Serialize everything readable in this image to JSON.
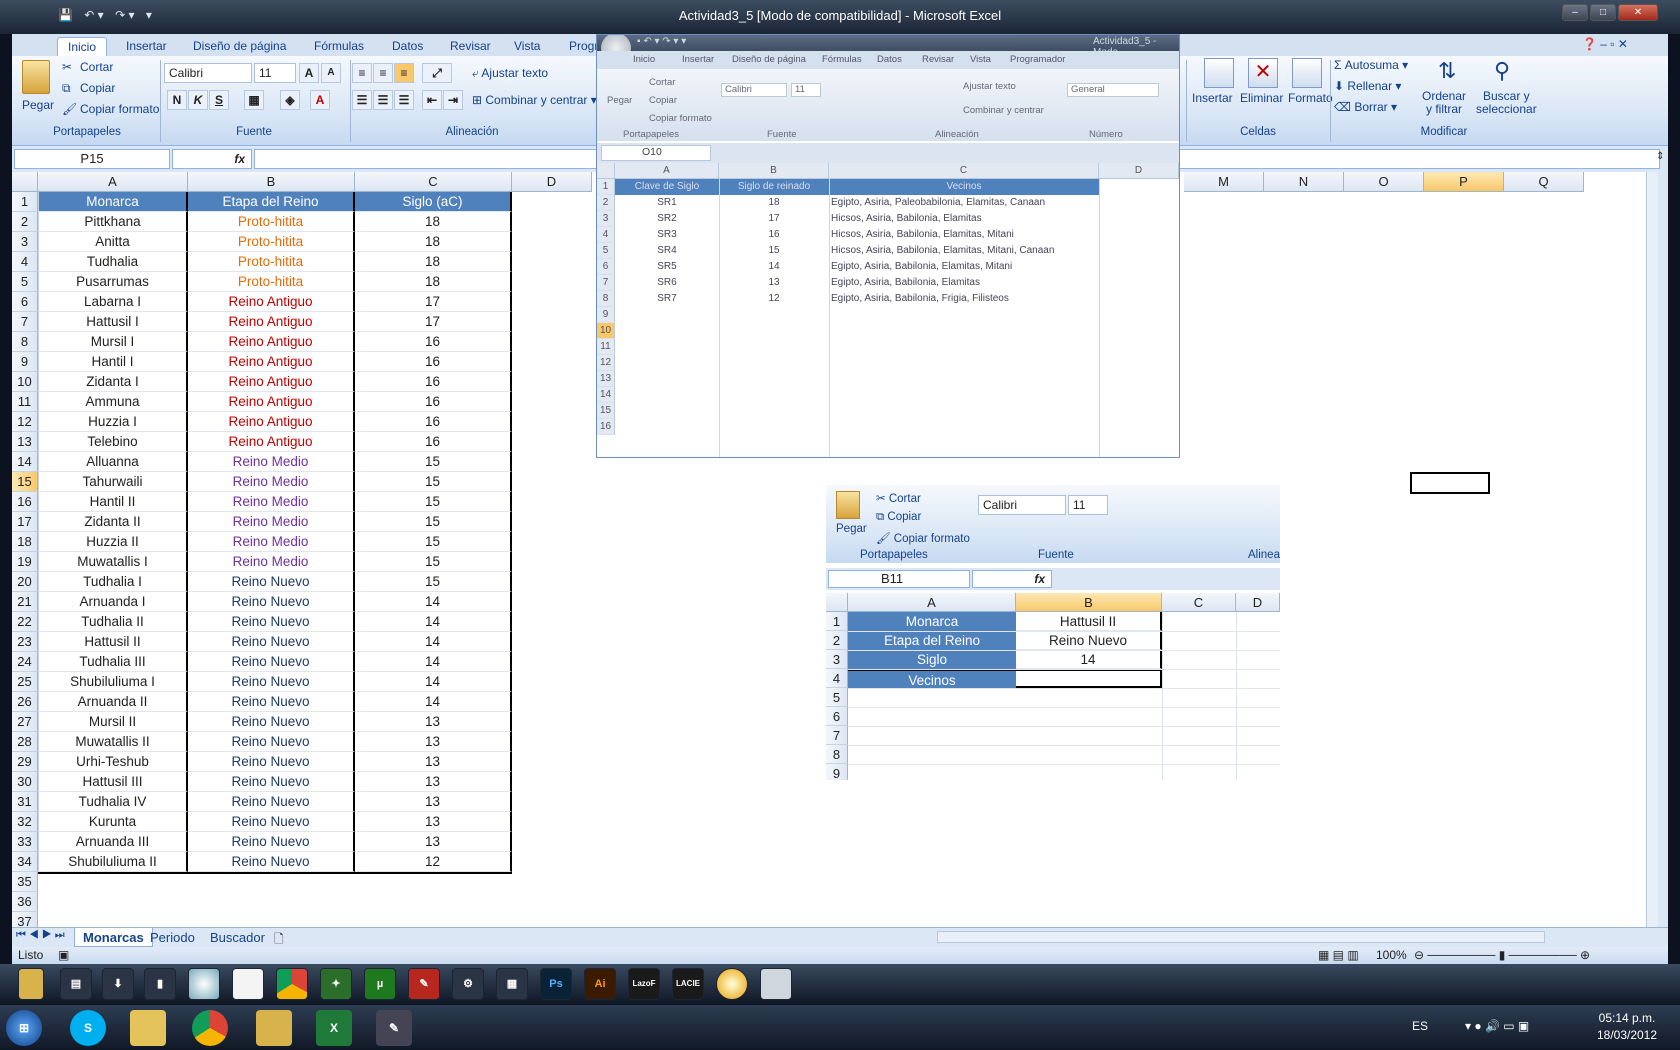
{
  "window": {
    "title": "Actividad3_5  [Modo de compatibilidad] - Microsoft Excel",
    "qat_icons": [
      "save-icon",
      "undo-icon",
      "redo-icon",
      "customize-icon"
    ]
  },
  "ribbon": {
    "tabs": [
      "Inicio",
      "Insertar",
      "Diseño de página",
      "Fórmulas",
      "Datos",
      "Revisar",
      "Vista",
      "Programador"
    ],
    "clipboard": {
      "paste": "Pegar",
      "cut": "Cortar",
      "copy": "Copiar",
      "format_painter": "Copiar formato",
      "label": "Portapapeles"
    },
    "font": {
      "name": "Calibri",
      "size": "11",
      "bold": "N",
      "italic": "K",
      "underline": "S",
      "label": "Fuente"
    },
    "alignment": {
      "wrap": "Ajustar texto",
      "merge": "Combinar y centrar",
      "label": "Alineación"
    },
    "cells": {
      "insert": "Insertar",
      "delete": "Eliminar",
      "format": "Formato",
      "label": "Celdas"
    },
    "editing": {
      "autosum": "Autosuma",
      "fill": "Rellenar",
      "clear": "Borrar",
      "sort": "Ordenar\ny filtrar",
      "find": "Buscar y\nseleccionar",
      "label": "Modificar"
    }
  },
  "formula_bar": {
    "name_box": "P15",
    "fx": "fx",
    "value": ""
  },
  "sheet": {
    "columns": [
      "A",
      "B",
      "C",
      "D",
      "M",
      "N",
      "O",
      "P",
      "Q"
    ],
    "header": [
      "Monarca",
      "Etapa del Reino",
      "Siglo (aC)"
    ],
    "rows": [
      [
        "Pittkhana",
        "Proto-hitita",
        "18"
      ],
      [
        "Anitta",
        "Proto-hitita",
        "18"
      ],
      [
        "Tudhalia",
        "Proto-hitita",
        "18"
      ],
      [
        "Pusarrumas",
        "Proto-hitita",
        "18"
      ],
      [
        "Labarna I",
        "Reino Antiguo",
        "17"
      ],
      [
        "Hattusil I",
        "Reino Antiguo",
        "17"
      ],
      [
        "Mursil I",
        "Reino Antiguo",
        "16"
      ],
      [
        "Hantil I",
        "Reino Antiguo",
        "16"
      ],
      [
        "Zidanta I",
        "Reino Antiguo",
        "16"
      ],
      [
        "Ammuna",
        "Reino Antiguo",
        "16"
      ],
      [
        "Huzzia I",
        "Reino Antiguo",
        "16"
      ],
      [
        "Telebino",
        "Reino Antiguo",
        "16"
      ],
      [
        "Alluanna",
        "Reino Medio",
        "15"
      ],
      [
        "Tahurwaili",
        "Reino Medio",
        "15"
      ],
      [
        "Hantil II",
        "Reino Medio",
        "15"
      ],
      [
        "Zidanta II",
        "Reino Medio",
        "15"
      ],
      [
        "Huzzia II",
        "Reino Medio",
        "15"
      ],
      [
        "Muwatallis I",
        "Reino Medio",
        "15"
      ],
      [
        "Tudhalia I",
        "Reino Nuevo",
        "15"
      ],
      [
        "Arnuanda I",
        "Reino Nuevo",
        "14"
      ],
      [
        "Tudhalia II",
        "Reino Nuevo",
        "14"
      ],
      [
        "Hattusil II",
        "Reino Nuevo",
        "14"
      ],
      [
        "Tudhalia III",
        "Reino Nuevo",
        "14"
      ],
      [
        "Shubiluliuma I",
        "Reino Nuevo",
        "14"
      ],
      [
        "Arnuanda II",
        "Reino Nuevo",
        "14"
      ],
      [
        "Mursil II",
        "Reino Nuevo",
        "13"
      ],
      [
        "Muwatallis II",
        "Reino Nuevo",
        "13"
      ],
      [
        "Urhi-Teshub",
        "Reino Nuevo",
        "13"
      ],
      [
        "Hattusil III",
        "Reino Nuevo",
        "13"
      ],
      [
        "Tudhalia IV",
        "Reino Nuevo",
        "13"
      ],
      [
        "Kurunta",
        "Reino Nuevo",
        "13"
      ],
      [
        "Arnuanda III",
        "Reino Nuevo",
        "13"
      ],
      [
        "Shubiluliuma II",
        "Reino Nuevo",
        "12"
      ]
    ],
    "row_numbers": [
      "1",
      "2",
      "3",
      "4",
      "5",
      "6",
      "7",
      "8",
      "9",
      "10",
      "11",
      "12",
      "13",
      "14",
      "15",
      "16",
      "17",
      "18",
      "19",
      "20",
      "21",
      "22",
      "23",
      "24",
      "25",
      "26",
      "27",
      "28",
      "29",
      "30",
      "31",
      "32",
      "33",
      "34",
      "35",
      "36",
      "37"
    ],
    "tabs": [
      "Monarcas",
      "Periodo",
      "Buscador"
    ]
  },
  "overlay1": {
    "title": "Actividad3_5 - Modo",
    "tabs": [
      "Inicio",
      "Insertar",
      "Diseño de página",
      "Fórmulas",
      "Datos",
      "Revisar",
      "Vista",
      "Programador"
    ],
    "clipboard": {
      "paste": "Pegar",
      "cut": "Cortar",
      "copy": "Copiar",
      "format_painter": "Copiar formato",
      "label": "Portapapeles"
    },
    "font": {
      "name": "Calibri",
      "size": "11",
      "label": "Fuente"
    },
    "alignment": {
      "wrap": "Ajustar texto",
      "merge": "Combinar y centrar",
      "label": "Alineación"
    },
    "number": {
      "format": "General",
      "label": "Número"
    },
    "name_box": "O10",
    "columns": [
      "A",
      "B",
      "C",
      "D"
    ],
    "header": [
      "Clave de Siglo",
      "Siglo de reinado",
      "Vecinos"
    ],
    "rows": [
      [
        "SR1",
        "18",
        "Egipto, Asiria, Paleobabilonia, Elamitas, Canaan"
      ],
      [
        "SR2",
        "17",
        "Hicsos, Asiria, Babilonia, Elamitas"
      ],
      [
        "SR3",
        "16",
        "Hicsos, Asiria, Babilonia, Elamitas, Mitani"
      ],
      [
        "SR4",
        "15",
        "Hicsos, Asiria, Babilonia, Elamitas, Mitani, Canaan"
      ],
      [
        "SR5",
        "14",
        "Egipto, Asiria, Babilonia, Elamitas, Mitani"
      ],
      [
        "SR6",
        "13",
        "Egipto, Asiria, Babilonia, Elamitas"
      ],
      [
        "SR7",
        "12",
        "Egipto, Asiria, Babilonia, Frigia, Filisteos"
      ]
    ],
    "row_numbers": [
      "1",
      "2",
      "3",
      "4",
      "5",
      "6",
      "7",
      "8",
      "9",
      "10",
      "11",
      "12",
      "13",
      "14",
      "15",
      "16"
    ]
  },
  "overlay2": {
    "clipboard": {
      "paste": "Pegar",
      "cut": "Cortar",
      "copy": "Copiar",
      "format_painter": "Copiar formato",
      "label": "Portapapeles"
    },
    "font": {
      "name": "Calibri",
      "size": "11",
      "label": "Fuente"
    },
    "alignment_label": "Alinea",
    "name_box": "B11",
    "columns": [
      "A",
      "B",
      "C",
      "D"
    ],
    "labels": [
      "Monarca",
      "Etapa del Reino",
      "Siglo",
      "Vecinos"
    ],
    "values": [
      "Hattusil II",
      "Reino Nuevo",
      "14",
      ""
    ],
    "row_numbers": [
      "1",
      "2",
      "3",
      "4",
      "5",
      "6",
      "7",
      "8",
      "9"
    ]
  },
  "status": {
    "ready": "Listo",
    "zoom": "100%"
  },
  "quickbar": [
    "Ps",
    "Ai",
    "LazoF",
    "LACIE"
  ],
  "taskbar": {
    "lang": "ES",
    "time": "05:14 p.m.",
    "date": "18/03/2012"
  },
  "colors": {
    "header_blue": "#4f81bd",
    "proto": "#e26b0a",
    "antiguo": "#c00000",
    "medio": "#7030a0",
    "nuevo": "#1f3864"
  }
}
